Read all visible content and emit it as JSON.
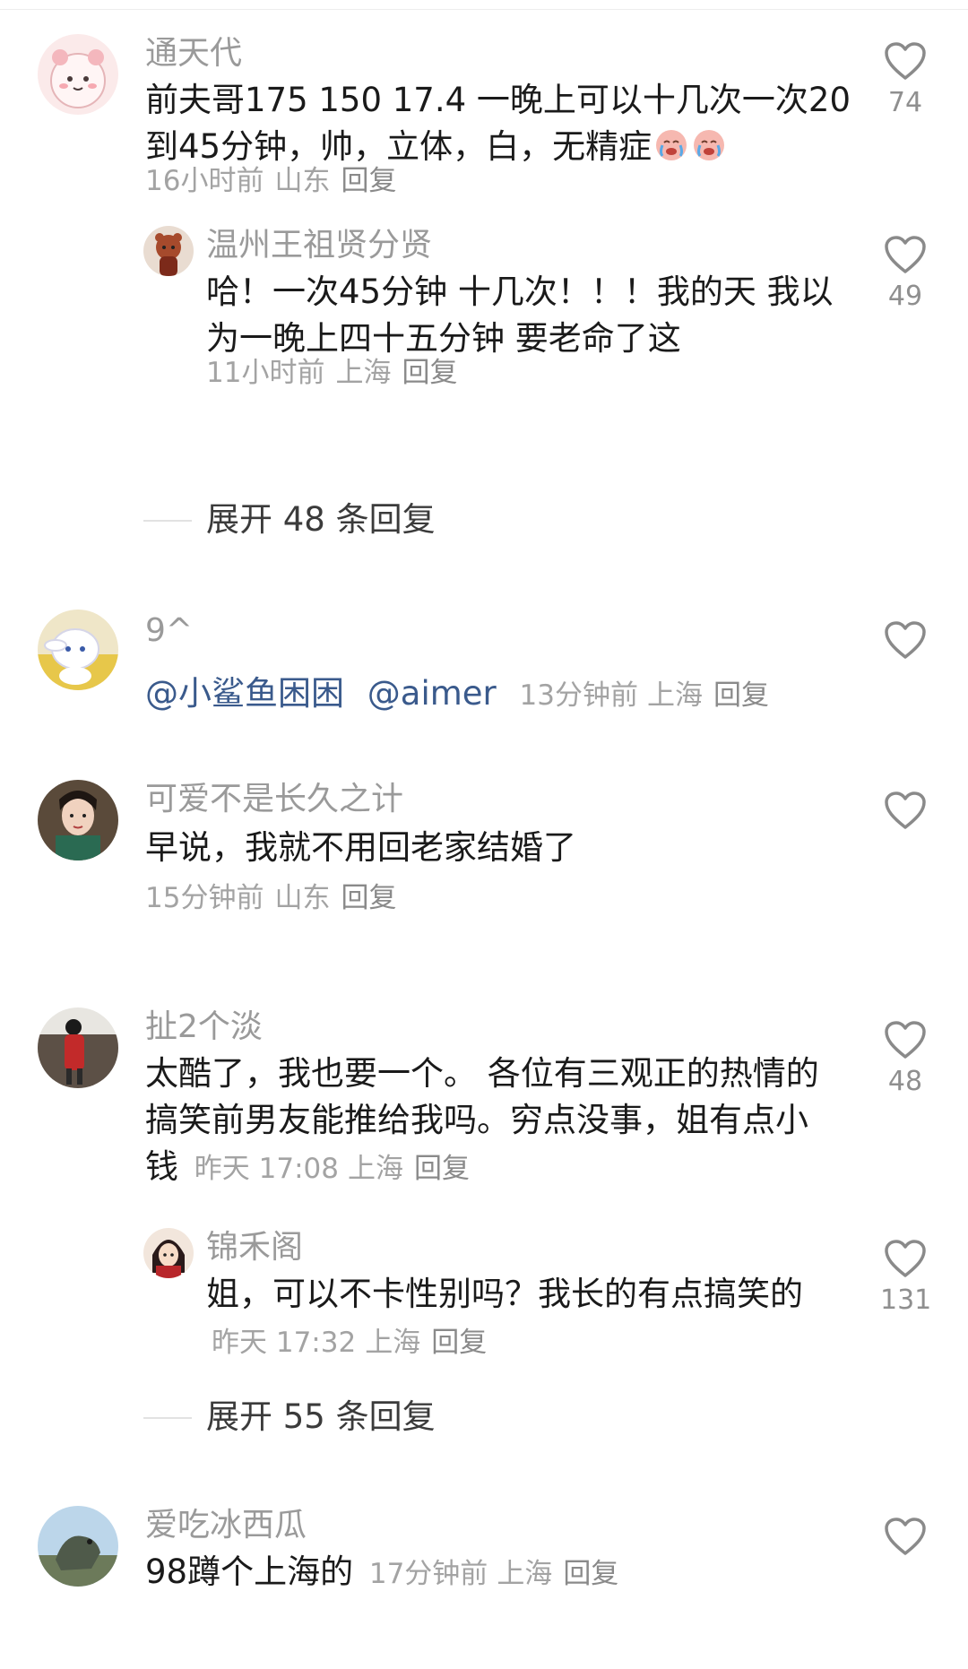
{
  "comments": [
    {
      "username": "通天代",
      "text": "前夫哥175 150 17.4 一晚上可以十几次一次20到45分钟，帅，立体，白，无精症",
      "time": "16小时前",
      "location": "山东",
      "reply_label": "回复",
      "likes": "74",
      "emoji": [
        "crying-face",
        "crying-face"
      ],
      "avatar_icon": "pink-bear-icon",
      "replies": [
        {
          "username": "温州王祖贤分贤",
          "text": "哈！一次45分钟 十几次！！！我的天 我以为一晚上四十五分钟 要老命了这",
          "time": "11小时前",
          "location": "上海",
          "reply_label": "回复",
          "likes": "49",
          "avatar_icon": "bear-figure-icon"
        }
      ],
      "expand_label": "展开 48 条回复"
    },
    {
      "username": "9^",
      "mentions": [
        "@小鲨鱼困困",
        "@aimer"
      ],
      "time": "13分钟前",
      "location": "上海",
      "reply_label": "回复",
      "likes": "",
      "avatar_icon": "cinnamoroll-icon"
    },
    {
      "username": "可爱不是长久之计",
      "text": "早说，我就不用回老家结婚了",
      "time": "15分钟前",
      "location": "山东",
      "reply_label": "回复",
      "likes": "",
      "avatar_icon": "portrait-icon"
    },
    {
      "username": "扯2个淡",
      "text": "太酷了，我也要一个。 各位有三观正的热情的搞笑前男友能推给我吗。穷点没事，姐有点小钱",
      "time": "昨天 17:08",
      "location": "上海",
      "reply_label": "回复",
      "likes": "48",
      "avatar_icon": "standing-person-icon",
      "replies": [
        {
          "username": "锦禾阁",
          "text": "姐，可以不卡性别吗？我长的有点搞笑的",
          "time": "昨天 17:32",
          "location": "上海",
          "reply_label": "回复",
          "likes": "131",
          "avatar_icon": "girl-illustration-icon"
        }
      ],
      "expand_label": "展开 55 条回复"
    },
    {
      "username": "爱吃冰西瓜",
      "text": "98蹲个上海的",
      "time": "17分钟前",
      "location": "上海",
      "reply_label": "回复",
      "likes": "",
      "avatar_icon": "dinosaur-statue-icon"
    }
  ],
  "colors": {
    "username": "#9a9a9a",
    "body_text": "#1a1a1a",
    "meta_text": "#a3a3a3",
    "mention": "#3a5a8c",
    "like_icon": "#8a8a8a"
  }
}
